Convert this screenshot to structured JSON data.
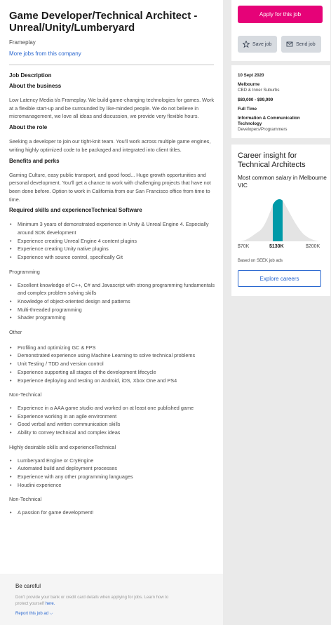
{
  "job": {
    "title": "Game Developer/Technical Architect - Unreal/Unity/Lumberyard",
    "advertiser": "Frameplay",
    "more_jobs_link": "More jobs from this company"
  },
  "description": {
    "heading": "Job Description",
    "about_business_heading": "About the business",
    "about_business_text": "Low Latency Media t/a Frameplay. We build game-changing technologies for games. Work at a flexible start-up and be surrounded by like-minded people. We do not believe in micromanagement, we love all ideas and discussion, we provide very flexible hours.",
    "about_role_heading": "About the role",
    "about_role_text": "Seeking a developer to join our tight-knit team. You'll work across multiple game engines, writing highly optimized code to be packaged and integrated into client titles.",
    "benefits_heading": "Benefits and perks",
    "benefits_text": "Gaming Culture, easy public transport, and good food... Huge growth opportunities and personal development. You'll get a chance to work with challenging projects that have not been done before. Option to work in California from our San Francisco office from time to time.",
    "required_heading": "Required skills and experienceTechnical Software",
    "technical_software": [
      "Minimum 3 years of demonstrated experience in Unity & Unreal Engine 4. Especially around SDK development",
      "Experience creating Unreal Engine 4 content plugins",
      "Experience creating Unity native plugins",
      "Experience with source control, specifically Git"
    ],
    "programming_heading": "Programming",
    "programming": [
      "Excellent knowledge of C++, C# and Javascript with strong programming fundamentals and complex problem solving skills",
      "Knowledge of object-oriented design and patterns",
      "Multi-threaded programming",
      "Shader programming"
    ],
    "other_heading": "Other",
    "other": [
      "Profiling and optimizing GC & FPS",
      "Demonstrated experience using Machine Learning to solve technical problems",
      "Unit Testing / TDD and version control",
      "Experience supporting all stages of the development lifecycle",
      "Experience deploying and testing on Android, iOS, Xbox One and PS4"
    ],
    "non_technical_heading": "Non-Technical",
    "non_technical": [
      "Experience in a AAA game studio and worked on at least one published game",
      "Experience working in an agile environment",
      "Good verbal and written communication skills",
      "Ability to convey technical and complex ideas"
    ],
    "desirable_heading": "Highly desirable skills and experienceTechnical",
    "desirable": [
      "Lumberyard Engine or CryEngine",
      "Automated build and deployment processes",
      "Experience with any other programming languages",
      "Houdini experience"
    ],
    "non_technical2_heading": "Non-Technical",
    "non_technical2": [
      "A passion for game development!"
    ]
  },
  "footer": {
    "title": "Be careful",
    "text_prefix": "Don't provide your bank or credit card details when applying for jobs. Learn how to protect yourself ",
    "text_link": "here.",
    "report": "Report this job ad"
  },
  "actions": {
    "apply": "Apply for this job",
    "save": "Save job",
    "send": "Send job"
  },
  "meta": {
    "date": "10 Sept 2020",
    "location": "Melbourne",
    "area": "CBD & Inner Suburbs",
    "salary": "$80,000 - $99,999",
    "work_type": "Full Time",
    "classification": "Information & Communication Technology",
    "sub_classification": "Developers/Programmers"
  },
  "career": {
    "title": "Career insight for Technical Architects",
    "subtitle": "Most common salary in Melbourne VIC",
    "low": "$70K",
    "mid": "$130K",
    "high": "$200K",
    "source": "Based on SEEK job ads",
    "button": "Explore careers"
  },
  "colors": {
    "accent": "#e60278",
    "link": "#2765cf",
    "highlight": "#009aa8"
  }
}
